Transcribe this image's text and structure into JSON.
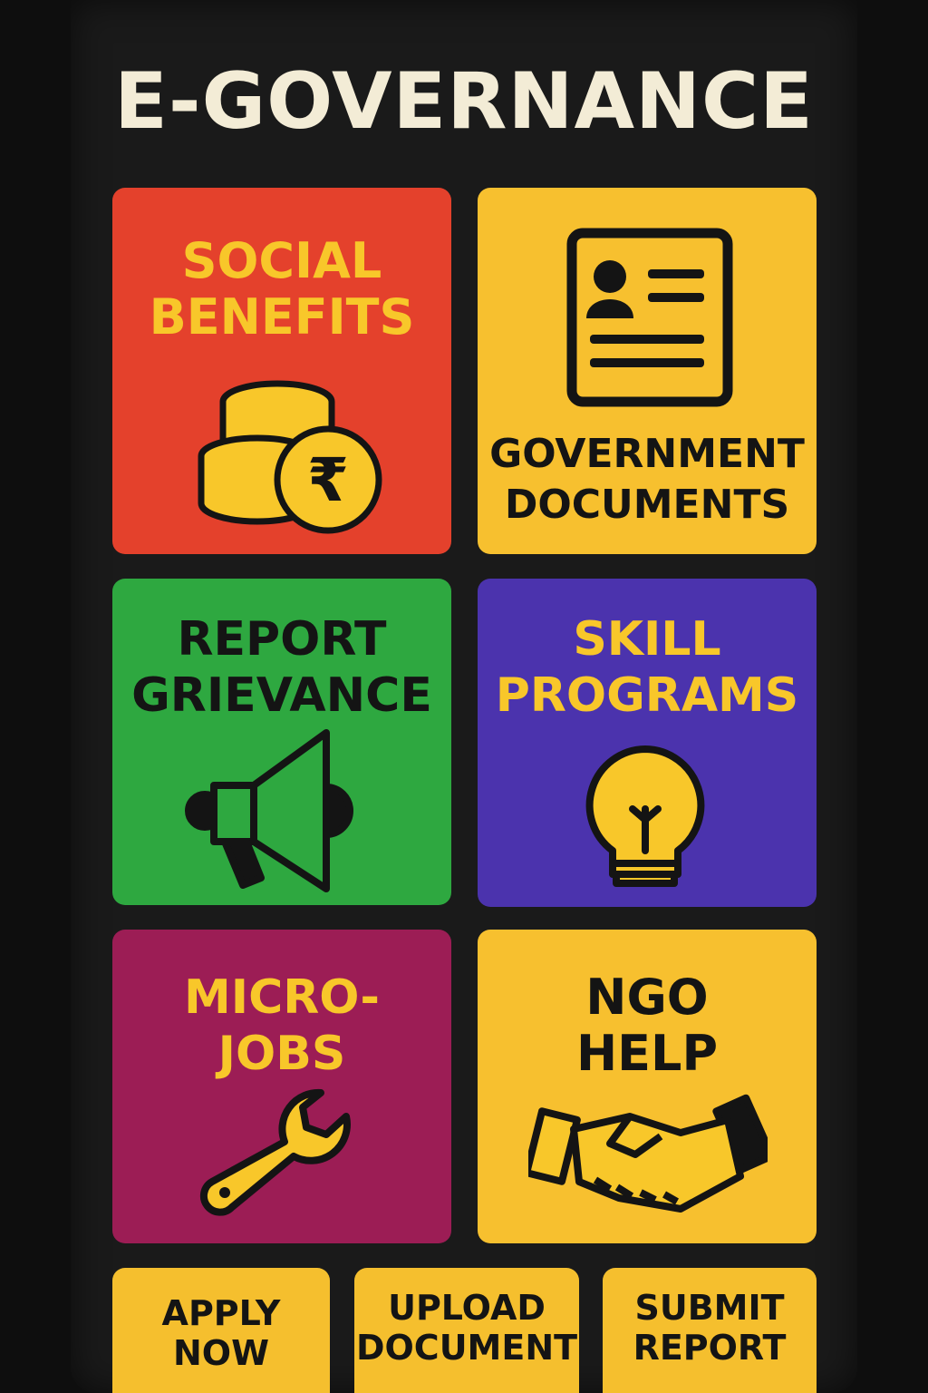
{
  "header": {
    "title": "E-GOVERNANCE"
  },
  "tiles": [
    {
      "label": "SOCIAL\nBENEFITS",
      "icon": "coins-rupee-icon",
      "bg": "#e4412c",
      "text_color": "#f8c72a"
    },
    {
      "label": "GOVERNMENT\nDOCUMENTS",
      "icon": "id-document-icon",
      "bg": "#f7c02f",
      "text_color": "#141414"
    },
    {
      "label": "REPORT\nGRIEVANCE",
      "icon": "megaphone-icon",
      "bg": "#2ea840",
      "text_color": "#141414"
    },
    {
      "label": "SKILL\nPROGRAMS",
      "icon": "lightbulb-icon",
      "bg": "#4b33ad",
      "text_color": "#f8c72a"
    },
    {
      "label": "MICRO-\nJOBS",
      "icon": "wrench-icon",
      "bg": "#9c1d55",
      "text_color": "#f8c72a"
    },
    {
      "label": "NGO\nHELP",
      "icon": "handshake-icon",
      "bg": "#f7c02f",
      "text_color": "#141414"
    }
  ],
  "actions": [
    {
      "label": "APPLY\nNOW"
    },
    {
      "label": "UPLOAD\nDOCUMENT"
    },
    {
      "label": "SUBMIT\nREPORT"
    }
  ]
}
